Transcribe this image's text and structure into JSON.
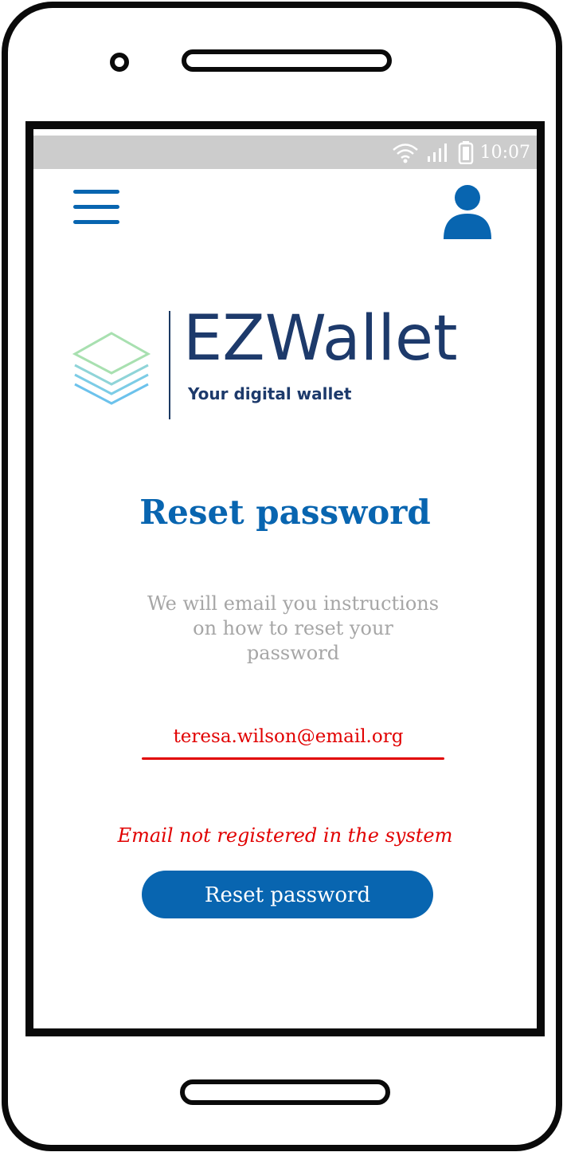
{
  "status_bar": {
    "time": "10:07",
    "icons": [
      "wifi-icon",
      "signal-icon",
      "battery-icon"
    ]
  },
  "header": {
    "menu_icon": "hamburger-menu-icon",
    "profile_icon": "user-icon"
  },
  "logo": {
    "name": "EZWallet",
    "tagline": "Your digital wallet"
  },
  "content": {
    "title": "Reset password",
    "instructions": "We will email you instructions on how to reset your password",
    "email_value": "teresa.wilson@email.org",
    "error_message": "Email not registered in the system",
    "button_label": "Reset password"
  },
  "colors": {
    "primary": "#0865b0",
    "error": "#e10000",
    "muted_text": "#a6a6a6",
    "status_bar": "#cccccc",
    "logo_text": "#1d3a6b"
  }
}
